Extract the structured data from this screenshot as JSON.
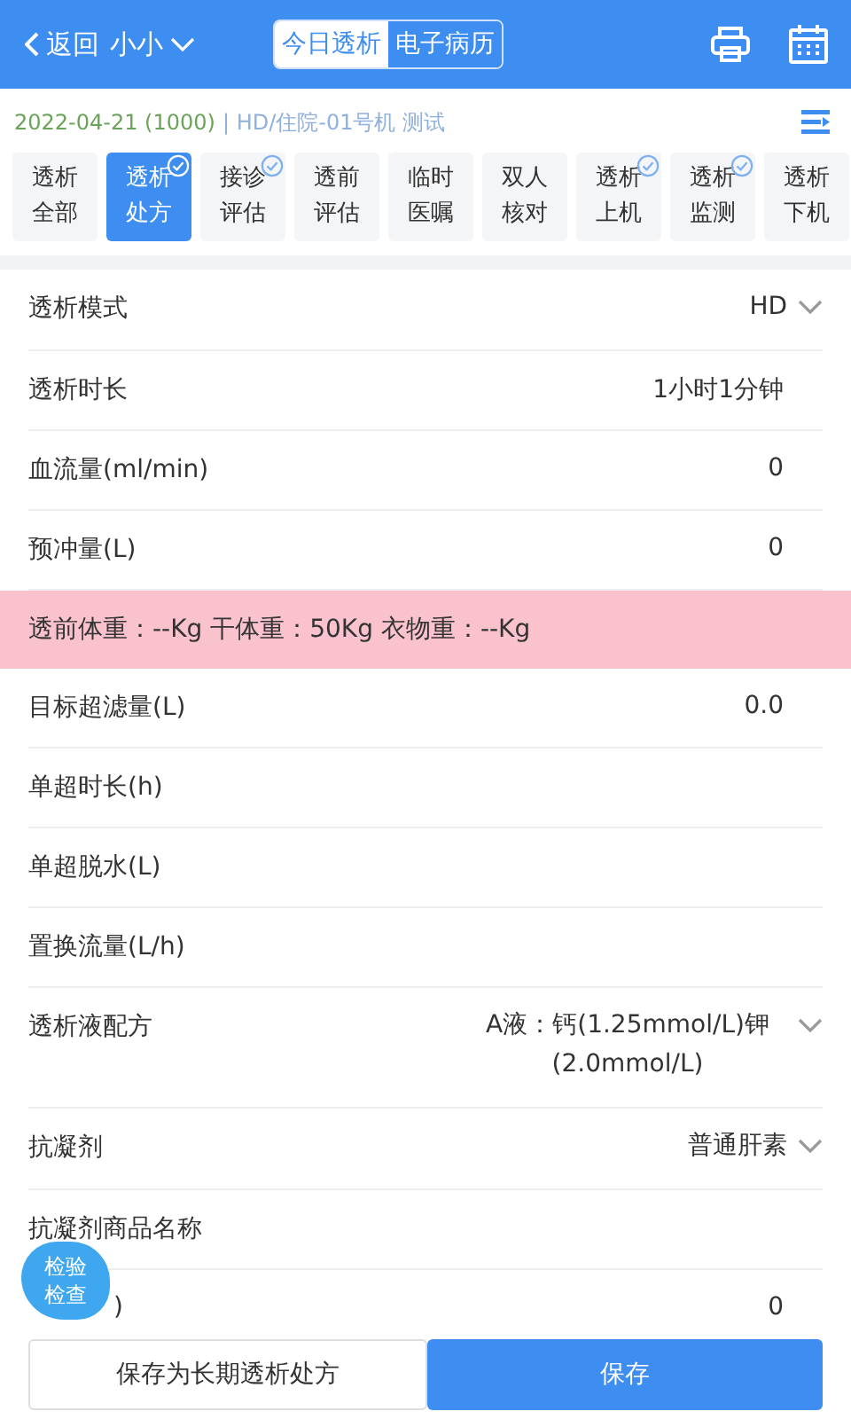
{
  "header": {
    "back": "返回",
    "patient": "小小",
    "segments": [
      {
        "label": "今日透析",
        "selected": true
      },
      {
        "label": "电子病历",
        "selected": false
      }
    ]
  },
  "info": {
    "date": "2022-04-21",
    "code": "(1000)",
    "detail": "| HD/住院-01号机 测试"
  },
  "tabs": [
    {
      "top": "透析",
      "bottom": "全部",
      "selected": false,
      "checked": false
    },
    {
      "top": "透析",
      "bottom": "处方",
      "selected": true,
      "checked": true
    },
    {
      "top": "接诊",
      "bottom": "评估",
      "selected": false,
      "checked": true
    },
    {
      "top": "透前",
      "bottom": "评估",
      "selected": false,
      "checked": false
    },
    {
      "top": "临时",
      "bottom": "医嘱",
      "selected": false,
      "checked": false
    },
    {
      "top": "双人",
      "bottom": "核对",
      "selected": false,
      "checked": false
    },
    {
      "top": "透析",
      "bottom": "上机",
      "selected": false,
      "checked": true
    },
    {
      "top": "透析",
      "bottom": "监测",
      "selected": false,
      "checked": true
    },
    {
      "top": "透析",
      "bottom": "下机",
      "selected": false,
      "checked": false
    }
  ],
  "rows": [
    {
      "kind": "select",
      "label": "透析模式",
      "value": "HD"
    },
    {
      "kind": "value",
      "label": "透析时长",
      "value": "1小时1分钟"
    },
    {
      "kind": "value",
      "label": "血流量(ml/min)",
      "value": "0"
    },
    {
      "kind": "value",
      "label": "预冲量(L)",
      "value": "0"
    },
    {
      "kind": "banner",
      "label": "透前体重：--Kg 干体重：50Kg 衣物重：--Kg"
    },
    {
      "kind": "value",
      "label": "目标超滤量(L)",
      "value": "0.0"
    },
    {
      "kind": "value",
      "label": "单超时长(h)"
    },
    {
      "kind": "value",
      "label": "单超脱水(L)"
    },
    {
      "kind": "value",
      "label": "置换流量(L/h)"
    },
    {
      "kind": "select",
      "label": "透析液配方",
      "value": "A液：钙(1.25mmol/L)钾(2.0mmol/L)"
    },
    {
      "kind": "select",
      "label": "抗凝剂",
      "value": "普通肝素"
    },
    {
      "kind": "value",
      "label": "抗凝剂商品名称"
    },
    {
      "kind": "value",
      "label": ")",
      "value": "0"
    }
  ],
  "float_button": "检验检查",
  "buttons": [
    {
      "label": "保存为长期透析处方",
      "kind": "secondary"
    },
    {
      "label": "保存",
      "kind": "primary"
    }
  ]
}
